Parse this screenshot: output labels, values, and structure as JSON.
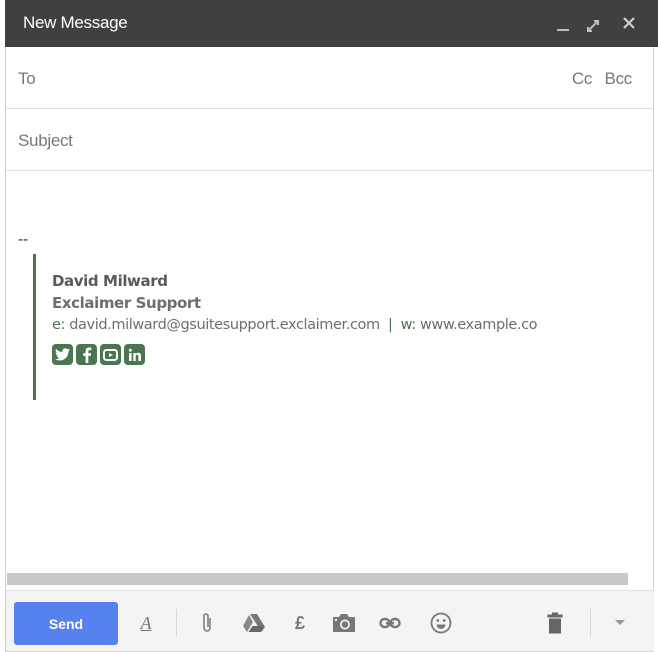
{
  "window": {
    "title": "New Message",
    "controls": [
      "minimize-icon",
      "expand-icon",
      "close-icon"
    ]
  },
  "fields": {
    "to_label": "To",
    "cc_label": "Cc",
    "bcc_label": "Bcc",
    "subject_label": "Subject"
  },
  "body": {
    "separator": "--",
    "signature": {
      "name": "David Milward",
      "company": "Exclaimer Support",
      "email_key": "e:",
      "email": "david.milward@gsuitesupport.exclaimer.com",
      "divider": "|",
      "web_key": "w:",
      "web": "www.example.co",
      "social": [
        "twitter-icon",
        "facebook-icon",
        "youtube-icon",
        "linkedin-icon"
      ],
      "accent_color": "#4a7550"
    }
  },
  "toolbar": {
    "send_label": "Send",
    "format_label": "A",
    "money_label": "£",
    "icons": [
      "formatting-icon",
      "attach-icon",
      "drive-icon",
      "money-icon",
      "photo-icon",
      "link-icon",
      "emoji-icon",
      "trash-icon",
      "more-options-icon"
    ],
    "send_color": "#5582ee"
  }
}
